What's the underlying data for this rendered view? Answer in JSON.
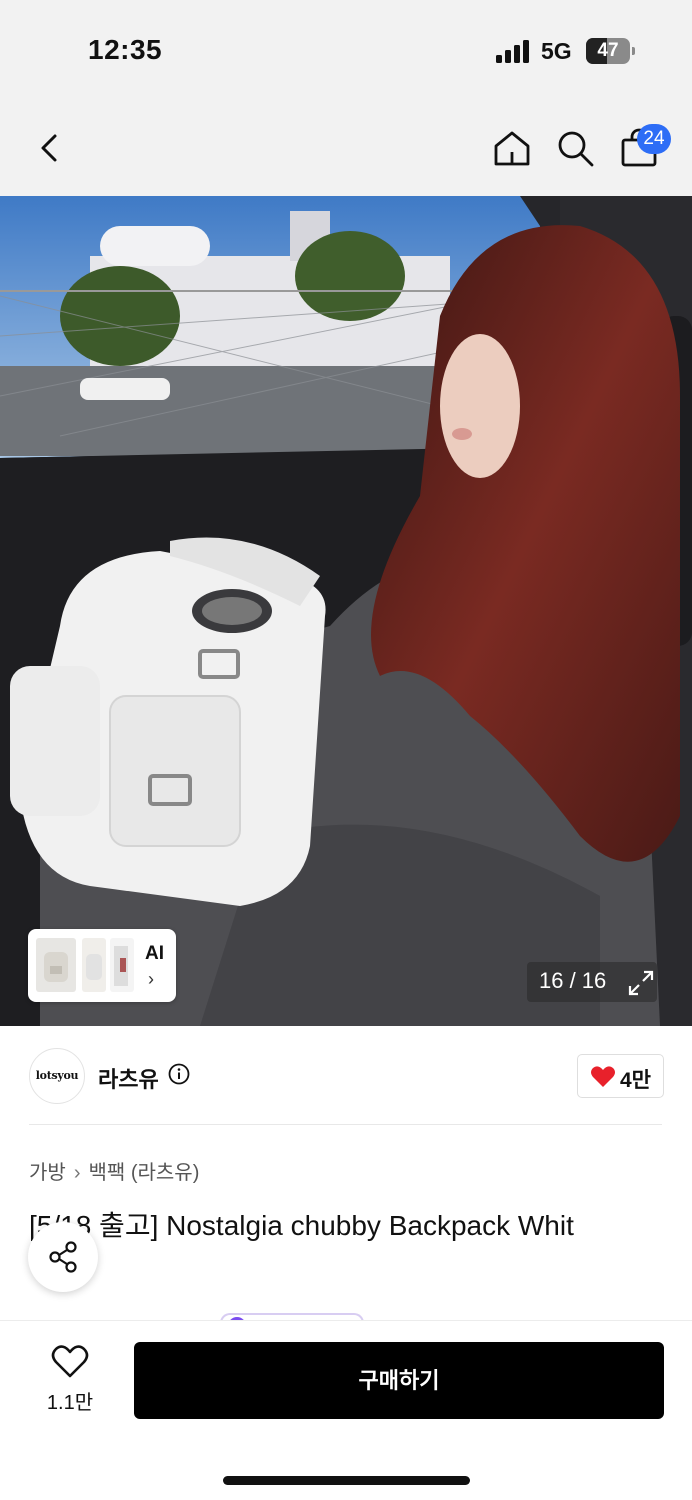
{
  "status_bar": {
    "time": "12:35",
    "network": "5G",
    "battery": "47",
    "icons": [
      "signal-icon",
      "battery-icon"
    ]
  },
  "nav": {
    "icons": [
      "back-icon",
      "home-icon",
      "search-icon",
      "cart-icon"
    ],
    "cart_badge": "24"
  },
  "hero": {
    "ai_label": "AI",
    "ai_chevron": "›",
    "pager": "16 / 16",
    "icons": [
      "expand-icon"
    ]
  },
  "seller": {
    "logo_text": "lotsyou",
    "name": "라츠유",
    "likes": "4만",
    "icons": [
      "info-icon",
      "heart-filled-icon"
    ]
  },
  "product": {
    "breadcrumb": [
      "가방",
      "백팩 (라츠유)"
    ],
    "breadcrumb_sep": "›",
    "title": "[5/18 출고] Nostalgia chubby Backpack Whit",
    "icons": [
      "share-icon"
    ]
  },
  "bottom_bar": {
    "wish_count": "1.1만",
    "buy_label": "구매하기",
    "icons": [
      "heart-outline-icon"
    ]
  },
  "colors": {
    "accent_blue": "#2d6df6",
    "like_red": "#e8212b",
    "buy_button": "#000000",
    "header_bg": "#f2f2f2"
  }
}
